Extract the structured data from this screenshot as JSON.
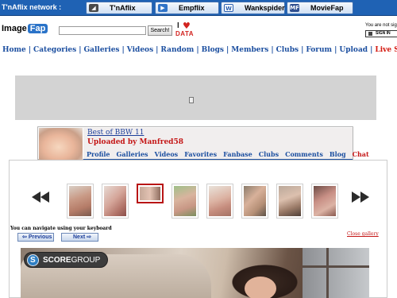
{
  "network": {
    "label": "T'nAflix network :",
    "sites": [
      {
        "name": "T'nAflix",
        "icon": "tnaflix-icon",
        "icon_color": "#4a4a4a",
        "icon_glyph": "◢"
      },
      {
        "name": "Empflix",
        "icon": "empflix-icon",
        "icon_color": "#2f73c7",
        "icon_glyph": "▶"
      },
      {
        "name": "Wankspider",
        "icon": "wankspider-icon",
        "icon_color": "#ffffff",
        "icon_glyph": "W"
      },
      {
        "name": "MovieFap",
        "icon": "moviefap-icon",
        "icon_color": "#2f4f8f",
        "icon_glyph": "MF"
      }
    ]
  },
  "header": {
    "logo_part1": "Image",
    "logo_part2": "Fap",
    "search_value": "",
    "search_button": "Search!",
    "idata_i": "I",
    "idata_heart": "♥",
    "idata_text": "DATA",
    "signin_note": "You are not sig",
    "signin_button": "SIGN IN"
  },
  "main_nav": {
    "items": [
      "Home",
      "Categories",
      "Galleries",
      "Videos",
      "Random",
      "Blogs",
      "Members",
      "Clubs",
      "Forum",
      "Upload",
      "Live Sex"
    ]
  },
  "gallery": {
    "title": "Best of BBW 11",
    "uploaded_by": "Uploaded by Manfred58",
    "tabs": [
      "Profile",
      "Galleries",
      "Videos",
      "Favorites",
      "Fanbase",
      "Clubs",
      "Comments",
      "Blog",
      "Chat"
    ]
  },
  "viewer": {
    "prev_arrow": "previous-arrows-icon",
    "next_arrow": "next-arrows-icon",
    "active_index": 2,
    "keyboard_note": "You can navigate using your keyboard",
    "previous_label": "Previous",
    "next_label": "Next",
    "close_gallery": "Close gallery",
    "watermark_letter": "S",
    "watermark_text_a": "SCORE",
    "watermark_text_b": "GROUP"
  },
  "colors": {
    "network_bar": "#1f62b4",
    "nav_link": "#1c4fa0",
    "live_link": "#d4180f",
    "uploader": "#c41616",
    "ad_placeholder": "#d3d3d3"
  }
}
